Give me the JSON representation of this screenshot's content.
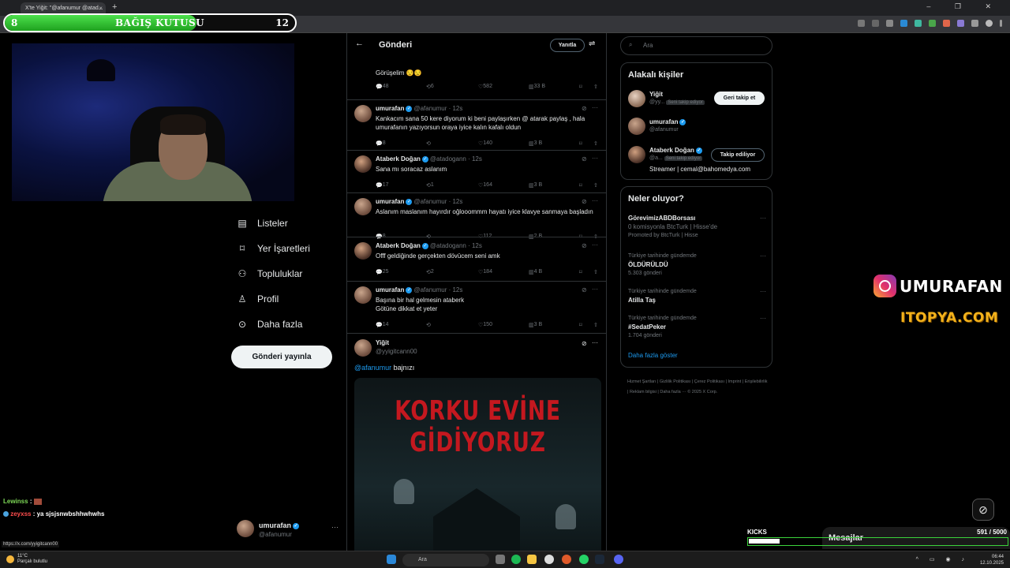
{
  "browser": {
    "tab_title": "X'te Yiğit: \"@afanumur @atad...",
    "tab_close": "×",
    "new_tab": "+",
    "window_controls": "– ❐ ✕"
  },
  "donation": {
    "left_value": "8",
    "title": "BAĞIŞ KUTUSU",
    "right_value": "12",
    "progress_fraction": 0.66
  },
  "nav": {
    "items": [
      {
        "label": "Listeler",
        "icon": "list-icon"
      },
      {
        "label": "Yer İşaretleri",
        "icon": "bookmark-icon"
      },
      {
        "label": "Topluluklar",
        "icon": "communities-icon"
      },
      {
        "label": "Profil",
        "icon": "profile-icon"
      },
      {
        "label": "Daha fazla",
        "icon": "more-circle-icon"
      }
    ],
    "post_button": "Gönderi yayınla"
  },
  "account": {
    "name": "umurafan",
    "handle": "@afanumur",
    "more": "···"
  },
  "chat": {
    "lines": [
      {
        "user": "Lewinss",
        "message": ":",
        "color": "#7ed957"
      },
      {
        "user": "zeyxss",
        "message": ": ya sjsjsnwbshhwhwhs",
        "color": "#ff4d4d"
      }
    ],
    "status_url": "https://x.com/yyigitcann00"
  },
  "center": {
    "back": "←",
    "title": "Gönderi",
    "reply_button": "Yanıtla",
    "top_tweet": {
      "text": "Görüşelim 😒😒",
      "stats": {
        "replies": "48",
        "reposts": "6",
        "likes": "582",
        "views": "33 B"
      }
    },
    "replies": [
      {
        "name": "umurafan",
        "handle": "@afanumur",
        "time": "12s",
        "text": "Kankacım sana 50 kere diyorum ki beni paylaşırken @ atarak paylaş , hala umurafanın yazıyorsun oraya iyice kalın kafalı oldun",
        "replies": "8",
        "reposts": "",
        "likes": "140",
        "views": "3 B"
      },
      {
        "name": "Ataberk Doğan",
        "handle": "@atadogann",
        "time": "12s",
        "text": "Sana mı soracaz aslanım",
        "replies": "17",
        "reposts": "1",
        "likes": "164",
        "views": "3 B"
      },
      {
        "name": "umurafan",
        "handle": "@afanumur",
        "time": "12s",
        "text": "Aslanım maslanım hayırdır oğlooommm hayatı iyice klavye sanmaya başladın",
        "replies": "8",
        "reposts": "",
        "likes": "112",
        "views": "2 B"
      },
      {
        "name": "Ataberk Doğan",
        "handle": "@atadogann",
        "time": "12s",
        "text": "Offf geldiğinde gerçekten dövücem seni amk",
        "replies": "25",
        "reposts": "2",
        "likes": "184",
        "views": "4 B"
      },
      {
        "name": "umurafan",
        "handle": "@afanumur",
        "time": "12s",
        "text": "Başına bir hal gelmesin ataberk\nGötüne dikkat et yeter",
        "replies": "14",
        "reposts": "",
        "likes": "150",
        "views": "3 B"
      }
    ],
    "main_tweet": {
      "name": "Yiğit",
      "handle": "@yyigitcann00",
      "mention": "@afanumur",
      "text": " bajnızı",
      "poster_line1": "KORKU EVİNE",
      "poster_line2": "GİDİYORUZ"
    }
  },
  "right": {
    "search_placeholder": "Ara",
    "related": {
      "title": "Alakalı kişiler",
      "people": [
        {
          "name": "Yiğit",
          "handle": "@yy...",
          "tag": "Seni takip ediyor",
          "button": "Geri takip et"
        },
        {
          "name": "umurafan",
          "handle": "@afanumur",
          "tag": "",
          "button": ""
        },
        {
          "name": "Ataberk Doğan",
          "handle": "@a...",
          "tag": "Seni takip ediyor",
          "button": "Takip ediliyor"
        }
      ],
      "bio": "Streamer | cemal@bahomedya.com"
    },
    "trends": {
      "title": "Neler oluyor?",
      "items": [
        {
          "context": "",
          "title": "GörevimizABDBorsası",
          "sub": "0 komisyonla BtcTurk | Hisse'de",
          "extra": "Promoted by BtcTurk | Hisse"
        },
        {
          "context": "Türkiye tarihinde gündemde",
          "title": "ÖLDÜRÜLDÜ",
          "sub": "5.303 gönderi",
          "extra": ""
        },
        {
          "context": "Türkiye tarihinde gündemde",
          "title": "Atilla Taş",
          "sub": "",
          "extra": ""
        },
        {
          "context": "Türkiye tarihinde gündemde",
          "title": "#SedatPeker",
          "sub": "1.704 gönderi",
          "extra": ""
        }
      ],
      "show_more": "Daha fazla göster"
    },
    "footer": "Hizmet Şartları | Gizlilik Politikası | Çerez Politikası | Imprint | Erişilebilirlik | Reklam bilgisi | Daha fazla ··· © 2025 X Corp."
  },
  "overlays": {
    "instagram": "UMURAFAN",
    "sponsor": "ITOPYA.COM",
    "messages": "Mesajlar",
    "kicks_label": "KICKS",
    "kicks_count": "591",
    "kicks_total": "/ 5000",
    "kicks_fraction": 0.118
  },
  "taskbar": {
    "weather_temp": "11°C",
    "weather_text": "Parçalı bulutlu",
    "search": "Ara",
    "time": "06:44",
    "date": "12.10.2025"
  },
  "colors": {
    "accent": "#1d9bf0",
    "green": "#3bd33b",
    "poster_red": "#c4181f"
  }
}
